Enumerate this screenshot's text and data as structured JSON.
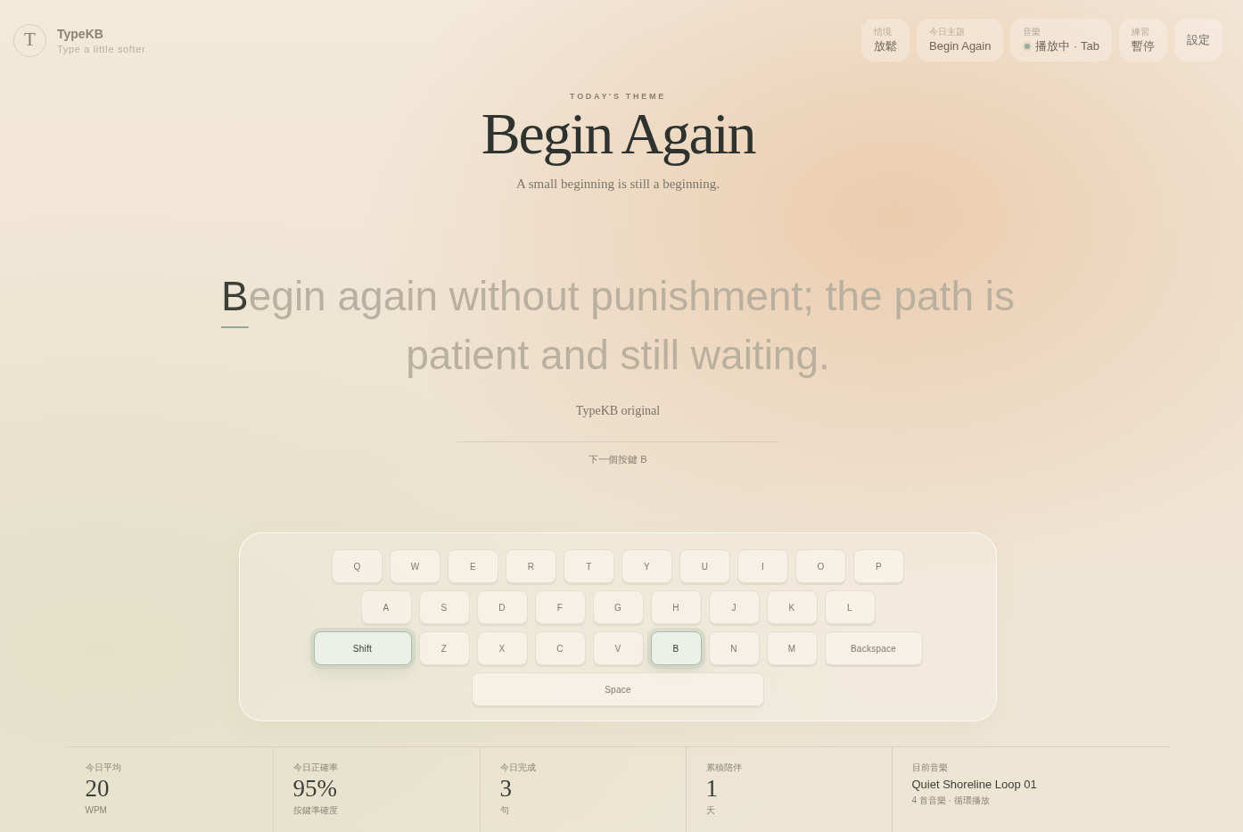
{
  "header": {
    "logo_letter": "T",
    "brand": "TypeKB",
    "tagline": "Type a little softer",
    "chips": [
      {
        "kind": "text",
        "label": "情境",
        "value": "放鬆"
      },
      {
        "kind": "text",
        "label": "今日主題",
        "value": "Begin Again"
      },
      {
        "kind": "playback",
        "label": "音樂",
        "value": "播放中 · Tab",
        "playing": true
      },
      {
        "kind": "text",
        "label": "練習",
        "value": "暫停"
      }
    ],
    "settings": "設定"
  },
  "theme": {
    "eyebrow": "TODAY'S THEME",
    "title": "Begin Again",
    "subtitle": "A small beginning is still a beginning."
  },
  "passage": {
    "typed": "B",
    "remaining": "egin again without punishment; the path is patient and still waiting.",
    "source": "TypeKB original",
    "next_key_hint": "下一個按鍵 B"
  },
  "keyboard": {
    "rows": [
      {
        "keys": [
          {
            "label": "Q",
            "kind": "letter",
            "highlighted": false
          },
          {
            "label": "W",
            "kind": "letter",
            "highlighted": false
          },
          {
            "label": "E",
            "kind": "letter",
            "highlighted": false
          },
          {
            "label": "R",
            "kind": "letter",
            "highlighted": false
          },
          {
            "label": "T",
            "kind": "letter",
            "highlighted": false
          },
          {
            "label": "Y",
            "kind": "letter",
            "highlighted": false
          },
          {
            "label": "U",
            "kind": "letter",
            "highlighted": false
          },
          {
            "label": "I",
            "kind": "letter",
            "highlighted": false
          },
          {
            "label": "O",
            "kind": "letter",
            "highlighted": false
          },
          {
            "label": "P",
            "kind": "letter",
            "highlighted": false
          }
        ]
      },
      {
        "keys": [
          {
            "label": "A",
            "kind": "letter",
            "highlighted": false
          },
          {
            "label": "S",
            "kind": "letter",
            "highlighted": false
          },
          {
            "label": "D",
            "kind": "letter",
            "highlighted": false
          },
          {
            "label": "F",
            "kind": "letter",
            "highlighted": false
          },
          {
            "label": "G",
            "kind": "letter",
            "highlighted": false
          },
          {
            "label": "H",
            "kind": "letter",
            "highlighted": false
          },
          {
            "label": "J",
            "kind": "letter",
            "highlighted": false
          },
          {
            "label": "K",
            "kind": "letter",
            "highlighted": false
          },
          {
            "label": "L",
            "kind": "letter",
            "highlighted": false
          }
        ]
      },
      {
        "keys": [
          {
            "label": "Shift",
            "kind": "wide",
            "highlighted": true
          },
          {
            "label": "Z",
            "kind": "letter",
            "highlighted": false
          },
          {
            "label": "X",
            "kind": "letter",
            "highlighted": false
          },
          {
            "label": "C",
            "kind": "letter",
            "highlighted": false
          },
          {
            "label": "V",
            "kind": "letter",
            "highlighted": false
          },
          {
            "label": "B",
            "kind": "letter",
            "highlighted": true
          },
          {
            "label": "N",
            "kind": "letter",
            "highlighted": false
          },
          {
            "label": "M",
            "kind": "letter",
            "highlighted": false
          },
          {
            "label": "Backspace",
            "kind": "wide",
            "highlighted": false
          }
        ]
      },
      {
        "keys": [
          {
            "label": "Space",
            "kind": "space",
            "highlighted": false
          }
        ]
      }
    ]
  },
  "stats": [
    {
      "label": "今日平均",
      "value": "20",
      "unit": "WPM"
    },
    {
      "label": "今日正確率",
      "value": "95%",
      "unit": "按鍵準確度"
    },
    {
      "label": "今日完成",
      "value": "3",
      "unit": "句"
    },
    {
      "label": "累積陪伴",
      "value": "1",
      "unit": "天"
    }
  ],
  "now_playing": {
    "label": "目前音樂",
    "title": "Quiet Shoreline Loop 01",
    "detail": "4 首音樂 · 循環播放"
  }
}
